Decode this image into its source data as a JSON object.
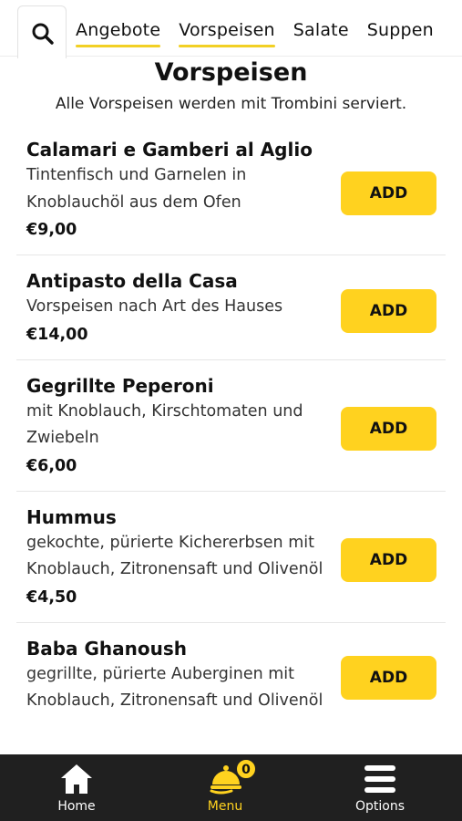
{
  "tabs": [
    {
      "label": "Angebote",
      "underlined": true
    },
    {
      "label": "Vorspeisen",
      "underlined": true
    },
    {
      "label": "Salate",
      "underlined": false
    },
    {
      "label": "Suppen",
      "underlined": false
    }
  ],
  "section": {
    "title": "Vorspeisen",
    "subtitle": "Alle Vorspeisen werden mit Trombini serviert."
  },
  "items": [
    {
      "name": "Calamari e Gamberi al Aglio",
      "description": "Tintenfisch und Garnelen in Knoblauchöl aus dem Ofen",
      "price": "€9,00",
      "add_label": "ADD"
    },
    {
      "name": "Antipasto della Casa",
      "description": "Vorspeisen nach Art des Hauses",
      "price": "€14,00",
      "add_label": "ADD"
    },
    {
      "name": "Gegrillte Peperoni",
      "description": "mit Knoblauch, Kirschtomaten und Zwiebeln",
      "price": "€6,00",
      "add_label": "ADD"
    },
    {
      "name": "Hummus",
      "description": "gekochte, pürierte Kichererbsen mit Knoblauch, Zitronensaft und Olivenöl",
      "price": "€4,50",
      "add_label": "ADD"
    },
    {
      "name": "Baba Ghanoush",
      "description": "gegrillte, pürierte Auberginen mit Knoblauch, Zitronensaft und Olivenöl",
      "price": "",
      "add_label": "ADD"
    }
  ],
  "bottom_nav": {
    "home_label": "Home",
    "menu_label": "Menu",
    "options_label": "Options",
    "cart_count": "0"
  },
  "colors": {
    "accent": "#ffd21f",
    "nav_background": "#202020"
  },
  "icons": {
    "search": "search-icon",
    "home": "home-icon",
    "menu": "cloche-icon",
    "options": "hamburger-icon"
  }
}
